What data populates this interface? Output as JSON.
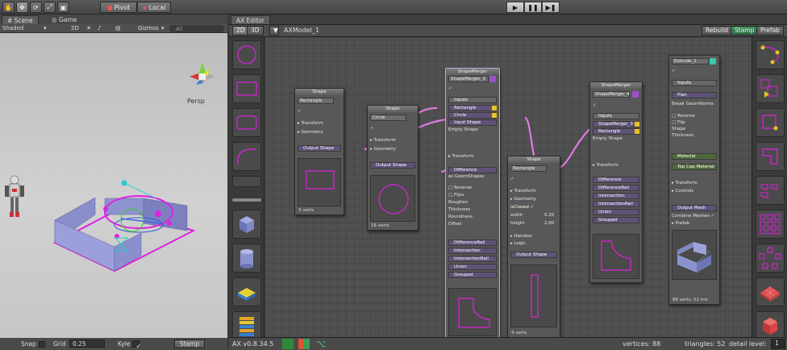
{
  "toolbar": {
    "pivot_label": "Pivot",
    "local_label": "Local"
  },
  "scene": {
    "tab_scene": "Scene",
    "tab_game": "Game",
    "shading_mode": "Shaded",
    "mode_2d": "2D",
    "gizmos_label": "Gizmos",
    "search_placeholder": "All",
    "persp_label": "Persp",
    "snap_label": "Snap",
    "grid_label": "Grid",
    "grid_value": "0.25",
    "kyle_label": "Kyle",
    "stamp_label": "Stamp"
  },
  "ax": {
    "tab_label": "AX Editor",
    "mode_2d": "2D",
    "mode_3d": "3D",
    "model_name": "AXModel_1",
    "rebuild_label": "Rebuild",
    "stamp_label": "Stamp",
    "prefab_label": "Prefab",
    "version": "AX v0.8.34.5",
    "vertices": "vertices: 88",
    "triangles": "triangles: 52",
    "detail_label": "detail level:",
    "detail_value": "1"
  },
  "nodes": {
    "rect": {
      "header": "Shape",
      "name": "Rectangle",
      "transform": "Transform",
      "geometry": "Geometry",
      "output": "Output Shape",
      "footer": "3 verts"
    },
    "circle": {
      "header": "Shape",
      "name": "Circle",
      "transform": "Transform",
      "geometry": "Geometry",
      "output": "Output Shape",
      "footer": "16 verts"
    },
    "merger1": {
      "header": "ShapeMerger",
      "name": "ShapeMerger_3",
      "inputs": "Inputs",
      "in1": "Rectangle",
      "in2": "Circle",
      "in3": "Input Shape",
      "in4": "Empty Shape",
      "transform": "Transform",
      "diff": "Difference",
      "geom": "as GeomShapes",
      "reverse": "Reverse",
      "flipx": "Flipx",
      "roughen": "Roughen",
      "thickness": "Thickness",
      "roundness": "Roundness",
      "offset": "Offset",
      "o1": "DifferenceRail",
      "o2": "Intersection",
      "o3": "IntersectionRail",
      "o4": "Union",
      "o5": "Grouped"
    },
    "rect2": {
      "header": "Shape",
      "name": "Rectangle",
      "transform": "Transform",
      "geometry": "Geometry",
      "closed": "isClosed",
      "width": "width",
      "width_val": "0.25",
      "height": "height",
      "height_val": "2.00",
      "handles": "Handles",
      "logic": "Logic",
      "output": "Output Shape",
      "footer": "4 verts"
    },
    "merger2": {
      "header": "ShapeMerger",
      "name": "ShapeMerger_4",
      "inputs": "Inputs",
      "in1": "ShapeMerger_3",
      "in2": "Rectangle",
      "in3": "Empty Shape",
      "transform": "Transform",
      "o1": "Difference",
      "o2": "DifferenceRail",
      "o3": "Intersection",
      "o4": "IntersectionRail",
      "o5": "Union",
      "o6": "Grouped"
    },
    "extrude": {
      "header": "Extrude_1",
      "inputs": "Inputs",
      "plan": "Plan",
      "break": "Break GeomNorms",
      "reverse": "Reverse",
      "flip": "Flip",
      "shape": "Shape",
      "thickness": "Thickness",
      "material": "Material",
      "topcap": "Top Cap Material",
      "transform": "Transform",
      "controls": "Controls",
      "output": "Output Mesh",
      "combine": "Combine Meshes",
      "prefab": "Prefab",
      "footer": "88 verts, 52 tris"
    }
  },
  "colors": {
    "accent_magenta": "#e020e0",
    "wire_pink": "#e07ae0",
    "port_yellow": "#e8c420",
    "port_green": "#32c832"
  }
}
